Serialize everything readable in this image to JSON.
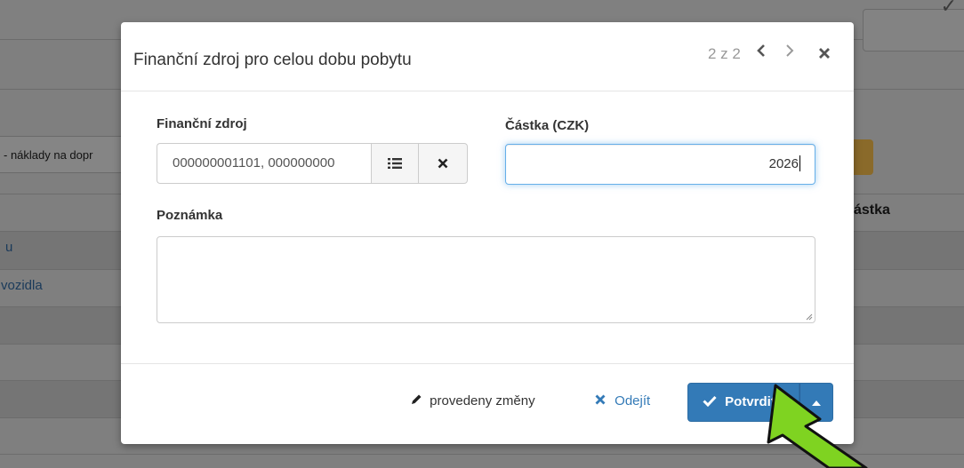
{
  "background": {
    "select_text": "- náklady na dopr",
    "column_header": "ástka",
    "links": [
      "u",
      "vozidla"
    ]
  },
  "modal": {
    "title": "Finanční zdroj pro celou dobu pobytu",
    "pager": "2 z 2",
    "fields": {
      "fund_label": "Finanční zdroj",
      "fund_value": "000000001101, 000000000",
      "amount_label": "Částka (CZK)",
      "amount_value": "2026",
      "note_label": "Poznámka",
      "note_value": ""
    },
    "footer": {
      "changes_label": "provedeny změny",
      "leave_label": "Odejít",
      "confirm_label": "Potvrdit"
    }
  },
  "colors": {
    "primary": "#337ab7",
    "focus_border": "#66afe9",
    "arrow_fill": "#7fd321"
  },
  "icons": [
    "list-icon",
    "clear-icon",
    "chevron-left-icon",
    "chevron-right-icon",
    "close-icon",
    "pencil-icon",
    "times-icon",
    "check-icon",
    "caret-up-icon",
    "pointer-arrow"
  ]
}
